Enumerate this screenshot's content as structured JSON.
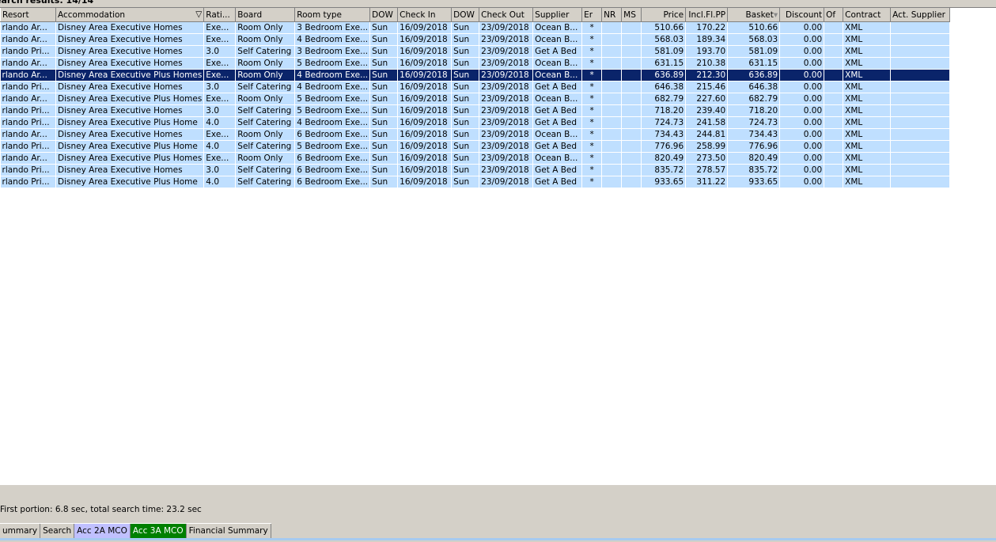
{
  "title": "earch results: 14/14",
  "columns": [
    "Resort",
    "Accommodation",
    "Rati...",
    "Board",
    "Room type",
    "DOW",
    "Check In",
    "DOW",
    "Check Out",
    "Supplier",
    "Er",
    "NR",
    "MS",
    "Price",
    "Incl.Fl.PP",
    "Basket",
    "Discount",
    "Of",
    "Contract",
    "Act. Supplier"
  ],
  "rows": [
    [
      "rlando Ar...",
      "Disney Area Executive Homes",
      "Exe...",
      "Room Only",
      "3 Bedroom Exe...",
      "Sun",
      "16/09/2018",
      "Sun",
      "23/09/2018",
      "Ocean B...",
      "*",
      "",
      "",
      "510.66",
      "170.22",
      "510.66",
      "0.00",
      "",
      "XML",
      ""
    ],
    [
      "rlando Ar...",
      "Disney Area Executive Homes",
      "Exe...",
      "Room Only",
      "4 Bedroom Exe...",
      "Sun",
      "16/09/2018",
      "Sun",
      "23/09/2018",
      "Ocean B...",
      "*",
      "",
      "",
      "568.03",
      "189.34",
      "568.03",
      "0.00",
      "",
      "XML",
      ""
    ],
    [
      "rlando Pri...",
      "Disney Area Executive Homes",
      "3.0",
      "Self Catering",
      "3 Bedroom Exe...",
      "Sun",
      "16/09/2018",
      "Sun",
      "23/09/2018",
      "Get A Bed",
      "*",
      "",
      "",
      "581.09",
      "193.70",
      "581.09",
      "0.00",
      "",
      "XML",
      ""
    ],
    [
      "rlando Ar...",
      "Disney Area Executive Homes",
      "Exe...",
      "Room Only",
      "5 Bedroom Exe...",
      "Sun",
      "16/09/2018",
      "Sun",
      "23/09/2018",
      "Ocean B...",
      "*",
      "",
      "",
      "631.15",
      "210.38",
      "631.15",
      "0.00",
      "",
      "XML",
      ""
    ],
    [
      "rlando Ar...",
      "Disney Area Executive Plus Homes",
      "Exe...",
      "Room Only",
      "4 Bedroom Exe...",
      "Sun",
      "16/09/2018",
      "Sun",
      "23/09/2018",
      "Ocean B...",
      "*",
      "",
      "",
      "636.89",
      "212.30",
      "636.89",
      "0.00",
      "",
      "XML",
      ""
    ],
    [
      "rlando Pri...",
      "Disney Area Executive Homes",
      "3.0",
      "Self Catering",
      "4 Bedroom Exe...",
      "Sun",
      "16/09/2018",
      "Sun",
      "23/09/2018",
      "Get A Bed",
      "*",
      "",
      "",
      "646.38",
      "215.46",
      "646.38",
      "0.00",
      "",
      "XML",
      ""
    ],
    [
      "rlando Ar...",
      "Disney Area Executive Plus Homes",
      "Exe...",
      "Room Only",
      "5 Bedroom Exe...",
      "Sun",
      "16/09/2018",
      "Sun",
      "23/09/2018",
      "Ocean B...",
      "*",
      "",
      "",
      "682.79",
      "227.60",
      "682.79",
      "0.00",
      "",
      "XML",
      ""
    ],
    [
      "rlando Pri...",
      "Disney Area Executive Homes",
      "3.0",
      "Self Catering",
      "5 Bedroom Exe...",
      "Sun",
      "16/09/2018",
      "Sun",
      "23/09/2018",
      "Get A Bed",
      "*",
      "",
      "",
      "718.20",
      "239.40",
      "718.20",
      "0.00",
      "",
      "XML",
      ""
    ],
    [
      "rlando Pri...",
      "Disney Area Executive Plus Home",
      "4.0",
      "Self Catering",
      "4 Bedroom Exe...",
      "Sun",
      "16/09/2018",
      "Sun",
      "23/09/2018",
      "Get A Bed",
      "*",
      "",
      "",
      "724.73",
      "241.58",
      "724.73",
      "0.00",
      "",
      "XML",
      ""
    ],
    [
      "rlando Ar...",
      "Disney Area Executive Homes",
      "Exe...",
      "Room Only",
      "6 Bedroom Exe...",
      "Sun",
      "16/09/2018",
      "Sun",
      "23/09/2018",
      "Ocean B...",
      "*",
      "",
      "",
      "734.43",
      "244.81",
      "734.43",
      "0.00",
      "",
      "XML",
      ""
    ],
    [
      "rlando Pri...",
      "Disney Area Executive Plus Home",
      "4.0",
      "Self Catering",
      "5 Bedroom Exe...",
      "Sun",
      "16/09/2018",
      "Sun",
      "23/09/2018",
      "Get A Bed",
      "*",
      "",
      "",
      "776.96",
      "258.99",
      "776.96",
      "0.00",
      "",
      "XML",
      ""
    ],
    [
      "rlando Ar...",
      "Disney Area Executive Plus Homes",
      "Exe...",
      "Room Only",
      "6 Bedroom Exe...",
      "Sun",
      "16/09/2018",
      "Sun",
      "23/09/2018",
      "Ocean B...",
      "*",
      "",
      "",
      "820.49",
      "273.50",
      "820.49",
      "0.00",
      "",
      "XML",
      ""
    ],
    [
      "rlando Pri...",
      "Disney Area Executive Homes",
      "3.0",
      "Self Catering",
      "6 Bedroom Exe...",
      "Sun",
      "16/09/2018",
      "Sun",
      "23/09/2018",
      "Get A Bed",
      "*",
      "",
      "",
      "835.72",
      "278.57",
      "835.72",
      "0.00",
      "",
      "XML",
      ""
    ],
    [
      "rlando Pri...",
      "Disney Area Executive Plus Home",
      "4.0",
      "Self Catering",
      "6 Bedroom Exe...",
      "Sun",
      "16/09/2018",
      "Sun",
      "23/09/2018",
      "Get A Bed",
      "*",
      "",
      "",
      "933.65",
      "311.22",
      "933.65",
      "0.00",
      "",
      "XML",
      ""
    ]
  ],
  "selected_row": 4,
  "status": "First portion: 6.8 sec, total search time: 23.2 sec",
  "tabs": [
    {
      "label": "ummary",
      "color": "#d4d0c8",
      "text": "#000000"
    },
    {
      "label": "Search",
      "color": "#d4d0c8",
      "text": "#000000"
    },
    {
      "label": "Acc 2A MCO",
      "color": "#c0c0ff",
      "text": "#000000"
    },
    {
      "label": "Acc 3A MCO",
      "color": "#008000",
      "text": "#ffffff"
    },
    {
      "label": "Financial Summary",
      "color": "#d4d0c8",
      "text": "#000000"
    }
  ]
}
